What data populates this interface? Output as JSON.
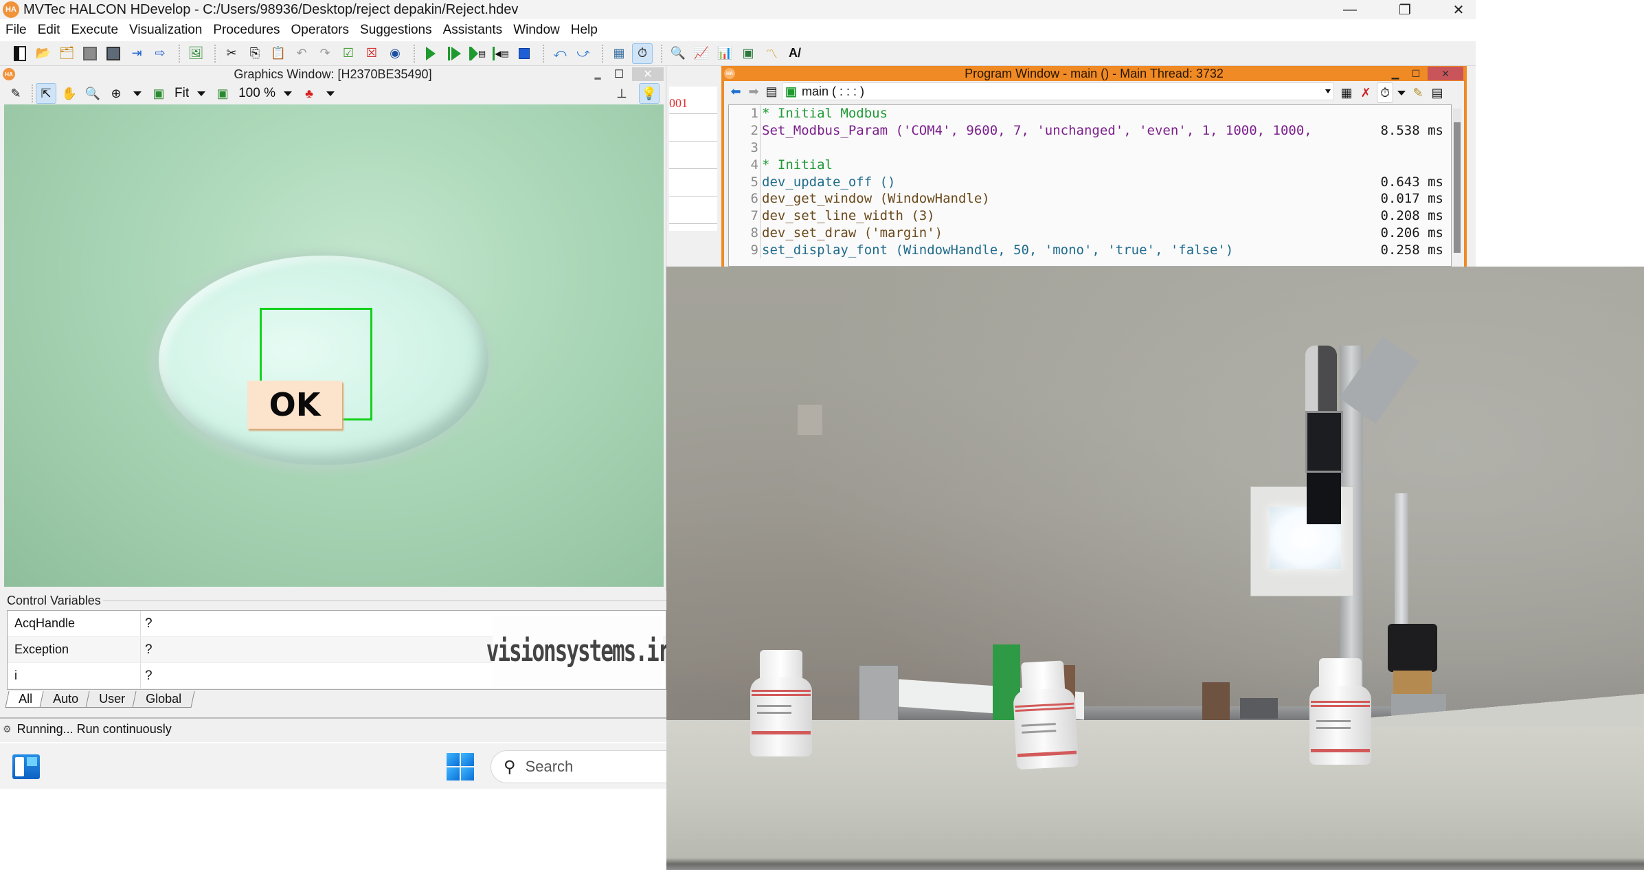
{
  "window": {
    "app_icon": "HA",
    "title": "MVTec HALCON HDevelop - C:/Users/98936/Desktop/reject depakin/Reject.hdev",
    "controls": {
      "minimize": "—",
      "restore": "❐",
      "close": "✕"
    }
  },
  "menu": {
    "items": [
      "File",
      "Edit",
      "Execute",
      "Visualization",
      "Procedures",
      "Operators",
      "Suggestions",
      "Assistants",
      "Window",
      "Help"
    ]
  },
  "toolbar": {
    "groups": [
      [
        "new-program-icon",
        "open-program-icon",
        "open-example-icon",
        "save-icon",
        "save-all-icon"
      ],
      [
        "insert-procedure-icon",
        "export-procedure-icon"
      ],
      [
        "image-acquisition-icon"
      ],
      [
        "cut-icon",
        "copy-icon",
        "paste-icon",
        "undo-icon",
        "redo-icon",
        "activate-line-icon",
        "deactivate-line-icon",
        "find-icon"
      ],
      [
        "run-icon",
        "step-over-icon",
        "step-into-icon",
        "step-out-icon",
        "stop-icon",
        "reset-program-icon",
        "reset-procedure-icon",
        "profiler-icon",
        "timer-icon"
      ],
      [
        "inspect-icon",
        "histogram-icon",
        "line-profile-icon",
        "feature-inspection-icon",
        "gray-histogram-icon",
        "ocr-icon"
      ]
    ],
    "active_icon": "timer-icon"
  },
  "graphics_window": {
    "title": "Graphics Window: [H2370BE35490]",
    "toolbar": {
      "fit_label": "Fit",
      "zoom_label": "100 %"
    },
    "overlay": {
      "result_label": "OK",
      "roi_color": "#12d11a",
      "label_background": "#fbe3cc"
    }
  },
  "variable_strip": {
    "visible_value": "001"
  },
  "control_variables": {
    "title": "Control Variables",
    "rows": [
      {
        "name": "AcqHandle",
        "value": "?"
      },
      {
        "name": "Exception",
        "value": "?"
      },
      {
        "name": "i",
        "value": "?"
      }
    ],
    "tabs": [
      "All",
      "Auto",
      "User",
      "Global"
    ],
    "active_tab": "All",
    "watermark": "visionsystems.ir"
  },
  "status_bar": {
    "text": "Running... Run continuously"
  },
  "program_window": {
    "title": "Program Window - main () - Main Thread: 3732",
    "procedure": "main ( : : : )",
    "accent": "#f08a24",
    "lines": [
      {
        "n": "1",
        "kind": "comment",
        "code": "* Initial Modbus",
        "time": ""
      },
      {
        "n": "2",
        "kind": "user",
        "code": "Set_Modbus_Param ('COM4', 9600, 7, 'unchanged', 'even', 1, 1000, 1000, ",
        "time": "8.538 ms"
      },
      {
        "n": "3",
        "kind": "blank",
        "code": "",
        "time": ""
      },
      {
        "n": "4",
        "kind": "comment",
        "code": "* Initial",
        "time": ""
      },
      {
        "n": "5",
        "kind": "op",
        "code": "dev_update_off ()",
        "time": "0.643 ms"
      },
      {
        "n": "6",
        "kind": "dev",
        "code": "dev_get_window (WindowHandle)",
        "time": "0.017 ms"
      },
      {
        "n": "7",
        "kind": "dev",
        "code": "dev_set_line_width (3)",
        "time": "0.208 ms"
      },
      {
        "n": "8",
        "kind": "dev",
        "code": "dev_set_draw ('margin')",
        "time": "0.206 ms"
      },
      {
        "n": "9",
        "kind": "op",
        "code": "set_display_font (WindowHandle, 50, 'mono', 'true', 'false')",
        "time": "0.258 ms"
      }
    ]
  },
  "taskbar": {
    "search_placeholder": "Search"
  },
  "camera_photo": {
    "description": "Live camera view of inspection station: three white medicine bottles with red-striped labels on a white conveyor, camera with ring light mounted on aluminum post, solenoid valve at right"
  }
}
